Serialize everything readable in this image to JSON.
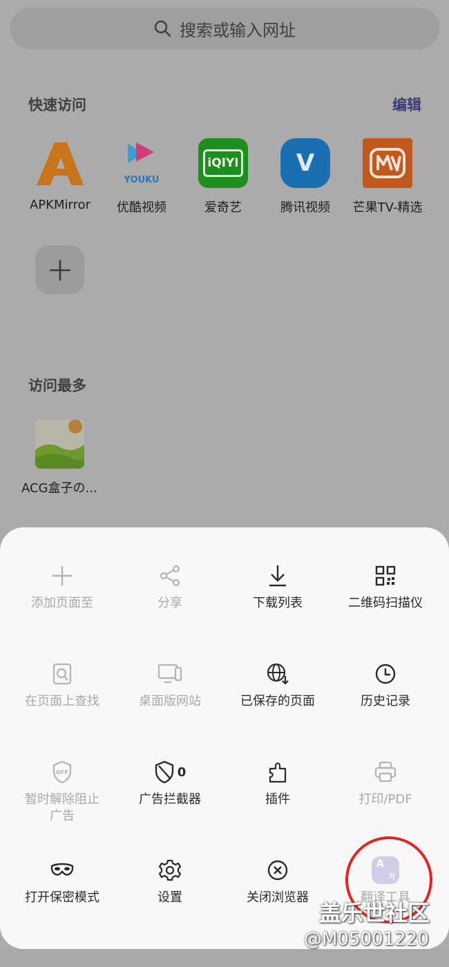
{
  "search": {
    "placeholder": "搜索或输入网址"
  },
  "quick_access": {
    "title": "快速访问",
    "edit_label": "编辑",
    "items": [
      {
        "label": "APKMirror",
        "icon": "apkmirror-logo"
      },
      {
        "label": "优酷视频",
        "icon": "youku-logo",
        "logo_text": "YOUKU"
      },
      {
        "label": "爱奇艺",
        "icon": "iqiyi-logo",
        "logo_text": "iQIYI"
      },
      {
        "label": "腾讯视频",
        "icon": "tencent-video-logo",
        "logo_text": "V"
      },
      {
        "label": "芒果TV-精选",
        "icon": "mango-tv-logo"
      }
    ]
  },
  "most_visited": {
    "title": "访问最多",
    "items": [
      {
        "label": "ACG盒子の..."
      }
    ]
  },
  "menu": {
    "items": [
      {
        "label": "添加页面至",
        "icon": "plus-icon",
        "enabled": false
      },
      {
        "label": "分享",
        "icon": "share-icon",
        "enabled": false
      },
      {
        "label": "下载列表",
        "icon": "download-icon",
        "enabled": true
      },
      {
        "label": "二维码扫描仪",
        "icon": "qr-code-icon",
        "enabled": true
      },
      {
        "label": "在页面上查找",
        "icon": "find-in-page-icon",
        "enabled": false
      },
      {
        "label": "桌面版网站",
        "icon": "desktop-icon",
        "enabled": false
      },
      {
        "label": "已保存的页面",
        "icon": "saved-pages-icon",
        "enabled": true
      },
      {
        "label": "历史记录",
        "icon": "clock-icon",
        "enabled": true
      },
      {
        "label": "暂时解除阻止广告",
        "icon": "shield-off-icon",
        "enabled": false,
        "badge": "OFF"
      },
      {
        "label": "广告拦截器",
        "icon": "shield-icon",
        "enabled": true,
        "count": "0"
      },
      {
        "label": "插件",
        "icon": "puzzle-icon",
        "enabled": true
      },
      {
        "label": "打印/PDF",
        "icon": "printer-icon",
        "enabled": false
      },
      {
        "label": "打开保密模式",
        "icon": "mask-icon",
        "enabled": true
      },
      {
        "label": "设置",
        "icon": "gear-icon",
        "enabled": true
      },
      {
        "label": "关闭浏览器",
        "icon": "close-circle-icon",
        "enabled": true
      },
      {
        "label": "翻译工具",
        "icon": "translate-icon",
        "enabled": false,
        "icon_text_a": "A",
        "icon_text_b": "가"
      }
    ]
  },
  "watermark": {
    "line1": "盖乐世社区",
    "line2": "@M05001220"
  },
  "colors": {
    "accent": "#3c3c78",
    "annotation": "#e52323",
    "sheet": "#f8f8f8"
  }
}
